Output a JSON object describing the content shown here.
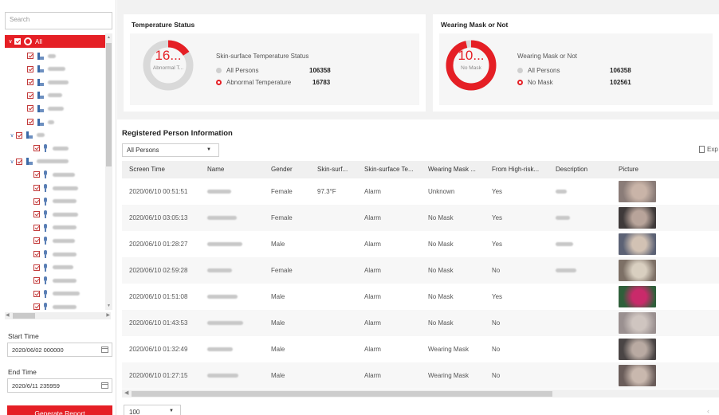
{
  "sidebar": {
    "search_placeholder": "Search",
    "root_label": "All",
    "start_time_label": "Start Time",
    "start_time_value": "2020/06/02 000000",
    "end_time_label": "End Time",
    "end_time_value": "2020/6/11 235959",
    "generate_button": "Generate Report"
  },
  "temperature_card": {
    "title": "Temperature Status",
    "donut_value": "16...",
    "donut_label": "Abnormal T...",
    "donut_fraction": 0.158,
    "stat_title": "Skin-surface Temperature Status",
    "rows": [
      {
        "label": "All Persons",
        "value": "106358"
      },
      {
        "label": "Abnormal Temperature",
        "value": "16783"
      }
    ]
  },
  "mask_card": {
    "title": "Wearing Mask or Not",
    "donut_value": "10...",
    "donut_label": "No Mask",
    "donut_fraction": 0.964,
    "stat_title": "Wearing Mask or Not",
    "rows": [
      {
        "label": "All Persons",
        "value": "106358"
      },
      {
        "label": "No Mask",
        "value": "102561"
      }
    ]
  },
  "registered": {
    "title": "Registered Person Information",
    "filter_value": "All Persons",
    "export_label": "Exp",
    "columns": [
      "Screen Time",
      "Name",
      "Gender",
      "Skin-surf...",
      "Skin-surface Te...",
      "Wearing Mask ...",
      "From High-risk...",
      "Description",
      "Picture"
    ],
    "rows": [
      {
        "time": "2020/06/10 00:51:51",
        "gender": "Female",
        "temp": "97.3°F",
        "status": "Alarm",
        "mask": "Unknown",
        "risk": "Yes"
      },
      {
        "time": "2020/06/10 03:05:13",
        "gender": "Female",
        "temp": "",
        "status": "Alarm",
        "mask": "No Mask",
        "risk": "Yes"
      },
      {
        "time": "2020/06/10 01:28:27",
        "gender": "Male",
        "temp": "",
        "status": "Alarm",
        "mask": "No Mask",
        "risk": "Yes"
      },
      {
        "time": "2020/06/10 02:59:28",
        "gender": "Female",
        "temp": "",
        "status": "Alarm",
        "mask": "No Mask",
        "risk": "No"
      },
      {
        "time": "2020/06/10 01:51:08",
        "gender": "Male",
        "temp": "",
        "status": "Alarm",
        "mask": "No Mask",
        "risk": "Yes"
      },
      {
        "time": "2020/06/10 01:43:53",
        "gender": "Male",
        "temp": "",
        "status": "Alarm",
        "mask": "No Mask",
        "risk": "No"
      },
      {
        "time": "2020/06/10 01:32:49",
        "gender": "Male",
        "temp": "",
        "status": "Alarm",
        "mask": "Wearing Mask",
        "risk": "No"
      },
      {
        "time": "2020/06/10 01:27:15",
        "gender": "Male",
        "temp": "",
        "status": "Alarm",
        "mask": "Wearing Mask",
        "risk": "No"
      }
    ],
    "page_size": "100"
  }
}
